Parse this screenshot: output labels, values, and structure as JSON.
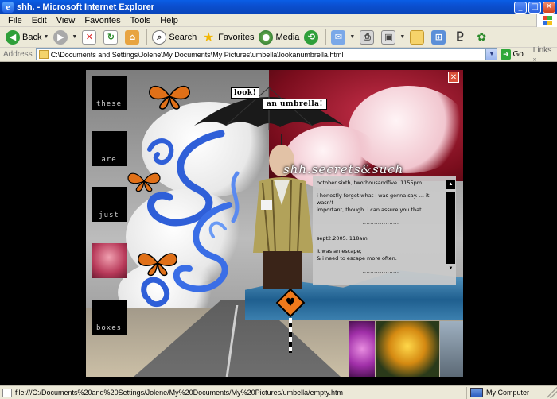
{
  "window": {
    "title": "shh. - Microsoft Internet Explorer",
    "minimize": "_",
    "maximize": "□",
    "close": "✕"
  },
  "menu": [
    "File",
    "Edit",
    "View",
    "Favorites",
    "Tools",
    "Help"
  ],
  "toolbar": {
    "back": "Back",
    "search": "Search",
    "favorites": "Favorites",
    "media": "Media"
  },
  "address": {
    "label": "Address",
    "url": "C:\\Documents and Settings\\Jolene\\My Documents\\My Pictures\\umbella\\lookanumbrella.html",
    "go": "Go",
    "links": "Links"
  },
  "page": {
    "close": "✕",
    "label_look": "look!",
    "label_umbrella": "an umbrella!",
    "side_words": [
      "these",
      "are",
      "just",
      "boxes"
    ],
    "blog_title": "shh.secrets&such",
    "entries": [
      {
        "date": "october sixth, twothousandfive. 1155pm.",
        "lines": [
          "i honestly forget what i was gonna say. ... it wasn't",
          "important, though. i can assure you that."
        ]
      },
      {
        "date": "sept2.2005. 118am.",
        "lines": [
          "it was an escape;",
          "& i need to escape more often."
        ]
      }
    ],
    "separator": "...................",
    "scroll_up": "▲",
    "scroll_down": "▼",
    "sign_symbol": "♥"
  },
  "status": {
    "text": "file:///C:/Documents%20and%20Settings/Jolene/My%20Documents/My%20Pictures/umbella/empty.htm",
    "zone": "My Computer"
  },
  "colors": {
    "xp_blue": "#0b4fd0",
    "chrome": "#ece9d8",
    "butterfly": "#e07018",
    "sky_red": "#9a1a2e",
    "swirl_blue": "#2f5fd8"
  },
  "icons": [
    "ie-icon",
    "back-arrow-icon",
    "forward-arrow-icon",
    "stop-icon",
    "refresh-icon",
    "home-icon",
    "search-icon",
    "favorites-star-icon",
    "media-icon",
    "history-icon",
    "mail-icon",
    "print-icon",
    "edit-icon",
    "folder-icon",
    "messenger-icon"
  ]
}
